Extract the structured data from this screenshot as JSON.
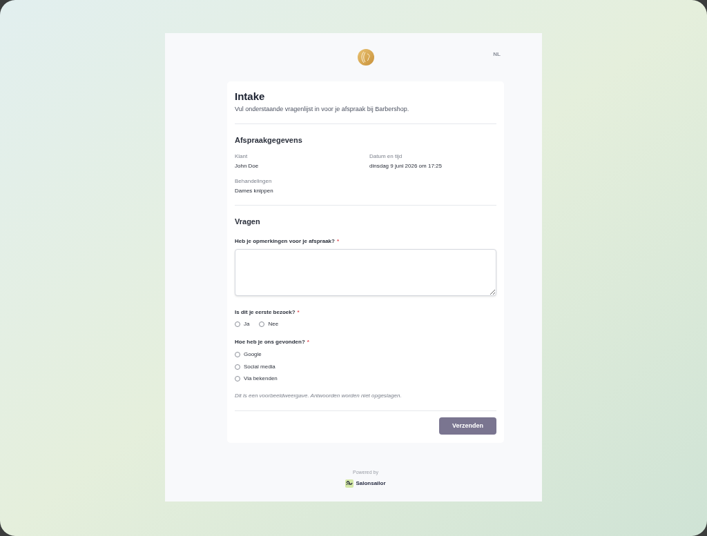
{
  "header": {
    "language": "NL"
  },
  "form": {
    "title": "Intake",
    "subtitle": "Vul onderstaande vragenlijst in voor je afspraak bij Barbershop."
  },
  "appointment": {
    "heading": "Afspraakgegevens",
    "fields": [
      {
        "label": "Klant",
        "value": "John Doe"
      },
      {
        "label": "Datum en tijd",
        "value": "dinsdag 9 juni 2026 om 17:25"
      },
      {
        "label": "Behandelingen",
        "value": "Dames knippen"
      }
    ]
  },
  "questions": {
    "heading": "Vragen",
    "items": [
      {
        "kind": "textarea",
        "label": "Heb je opmerkingen voor je afspraak?",
        "required_mark": "*"
      },
      {
        "kind": "inline",
        "label": "Is dit je eerste bezoek?",
        "required_mark": "*",
        "options": [
          {
            "label": "Ja",
            "selected": false
          },
          {
            "label": "Nee",
            "selected": false
          }
        ]
      },
      {
        "kind": "stacked",
        "label": "Hoe heb je ons gevonden?",
        "required_mark": "*",
        "options": [
          {
            "label": "Google",
            "selected": false
          },
          {
            "label": "Social media",
            "selected": false
          },
          {
            "label": "Via bekenden",
            "selected": false
          }
        ]
      }
    ]
  },
  "notice": "Dit is een voorbeeldweergave. Antwoorden worden niet opgeslagen.",
  "submit_button": "Verzenden",
  "footer": {
    "powered_by": "Powered by",
    "brand": "Salonsailor"
  }
}
